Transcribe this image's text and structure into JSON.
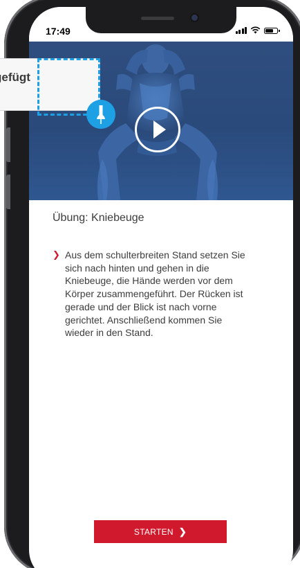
{
  "status_bar": {
    "time": "17:49",
    "icons": [
      "cellular-signal-icon",
      "wifi-icon",
      "battery-icon"
    ]
  },
  "video": {
    "play_icon": "play-icon"
  },
  "exercise": {
    "title": "Übung: Kniebeuge",
    "instruction": "Aus dem schulterbreiten Stand setzen Sie sich nach hinten und gehen in die Kniebeuge, die Hände werden vor dem Körper zusammengeführt. Der Rücken ist gerade und der Blick ist nach vorne gerichtet. Anschließend kommen Sie wieder in den Stand.",
    "bullet_icon": "chevron-right-icon"
  },
  "actions": {
    "start_label": "STARTEN",
    "start_icon": "chevron-right-icon"
  },
  "overlay": {
    "callout_text": "gefügt",
    "pin_icon": "pin-icon"
  },
  "colors": {
    "accent_red": "#d0192c",
    "highlight_blue": "#1ea0e4",
    "video_bg": "#2a4a7b"
  }
}
